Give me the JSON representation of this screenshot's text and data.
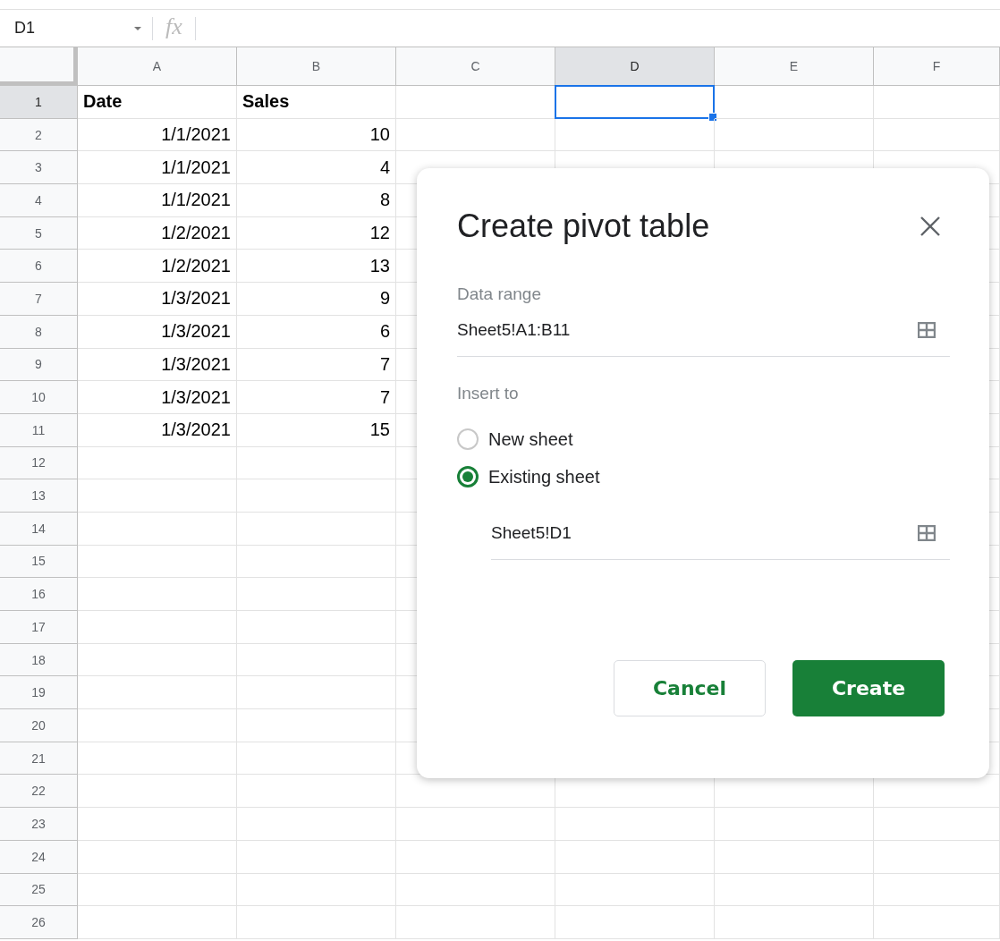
{
  "formula_bar": {
    "name_box": "D1",
    "function_label": "fx"
  },
  "columns": [
    {
      "label": "A",
      "selected": false
    },
    {
      "label": "B",
      "selected": false
    },
    {
      "label": "C",
      "selected": false
    },
    {
      "label": "D",
      "selected": true
    },
    {
      "label": "E",
      "selected": false
    },
    {
      "label": "F",
      "selected": false
    }
  ],
  "rows": [
    {
      "number": "1",
      "selected": true,
      "bold": true,
      "cells": [
        "Date",
        "Sales"
      ]
    },
    {
      "number": "2",
      "selected": false,
      "bold": false,
      "cells": [
        "1/1/2021",
        "10"
      ]
    },
    {
      "number": "3",
      "selected": false,
      "bold": false,
      "cells": [
        "1/1/2021",
        "4"
      ]
    },
    {
      "number": "4",
      "selected": false,
      "bold": false,
      "cells": [
        "1/1/2021",
        "8"
      ]
    },
    {
      "number": "5",
      "selected": false,
      "bold": false,
      "cells": [
        "1/2/2021",
        "12"
      ]
    },
    {
      "number": "6",
      "selected": false,
      "bold": false,
      "cells": [
        "1/2/2021",
        "13"
      ]
    },
    {
      "number": "7",
      "selected": false,
      "bold": false,
      "cells": [
        "1/3/2021",
        "9"
      ]
    },
    {
      "number": "8",
      "selected": false,
      "bold": false,
      "cells": [
        "1/3/2021",
        "6"
      ]
    },
    {
      "number": "9",
      "selected": false,
      "bold": false,
      "cells": [
        "1/3/2021",
        "7"
      ]
    },
    {
      "number": "10",
      "selected": false,
      "bold": false,
      "cells": [
        "1/3/2021",
        "7"
      ]
    },
    {
      "number": "11",
      "selected": false,
      "bold": false,
      "cells": [
        "1/3/2021",
        "15"
      ]
    },
    {
      "number": "12",
      "selected": false,
      "cells": []
    },
    {
      "number": "13",
      "selected": false,
      "cells": []
    },
    {
      "number": "14",
      "selected": false,
      "cells": []
    },
    {
      "number": "15",
      "selected": false,
      "cells": []
    },
    {
      "number": "16",
      "selected": false,
      "cells": []
    },
    {
      "number": "17",
      "selected": false,
      "cells": []
    },
    {
      "number": "18",
      "selected": false,
      "cells": []
    },
    {
      "number": "19",
      "selected": false,
      "cells": []
    },
    {
      "number": "20",
      "selected": false,
      "cells": []
    },
    {
      "number": "21",
      "selected": false,
      "cells": []
    },
    {
      "number": "22",
      "selected": false,
      "cells": []
    },
    {
      "number": "23",
      "selected": false,
      "cells": []
    },
    {
      "number": "24",
      "selected": false,
      "cells": []
    },
    {
      "number": "25",
      "selected": false,
      "cells": []
    },
    {
      "number": "26",
      "selected": false,
      "cells": []
    }
  ],
  "dialog": {
    "title": "Create pivot table",
    "data_range": {
      "label": "Data range",
      "value": "Sheet5!A1:B11"
    },
    "insert_to": {
      "label": "Insert to",
      "options": [
        {
          "label": "New sheet",
          "selected": false
        },
        {
          "label": "Existing sheet",
          "selected": true
        }
      ],
      "destination": "Sheet5!D1"
    },
    "buttons": [
      {
        "label": "Cancel",
        "kind": "secondary"
      },
      {
        "label": "Create",
        "kind": "primary"
      }
    ]
  }
}
